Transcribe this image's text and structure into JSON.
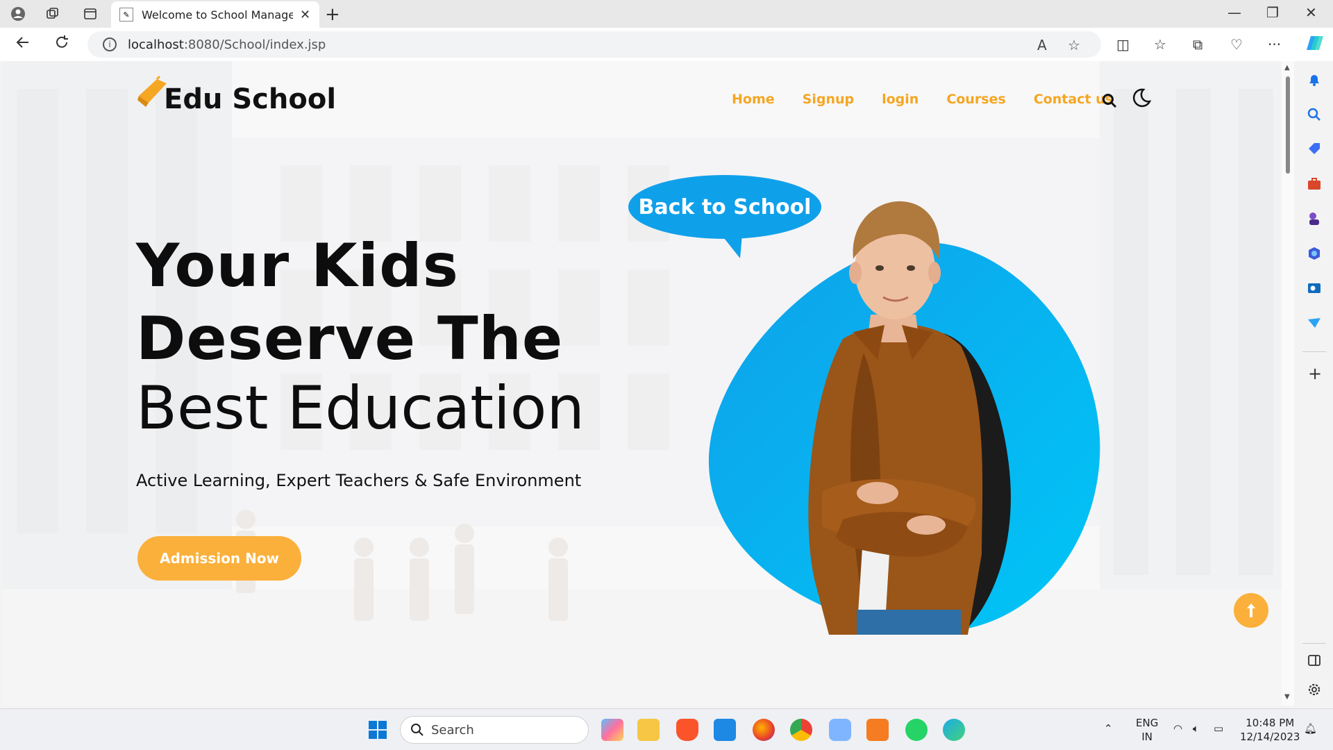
{
  "browser": {
    "tab_title": "Welcome to School Managemen",
    "url_host": "localhost",
    "url_rest": ":8080/School/index.jsp"
  },
  "site": {
    "logo_text": "Edu School",
    "nav": [
      "Home",
      "Signup",
      "login",
      "Courses",
      "Contact us"
    ],
    "bubble_text": "Back to School",
    "hero_line1": "Your Kids",
    "hero_line2": "Deserve The",
    "hero_line3": "Best Education",
    "subtitle": "Active Learning, Expert Teachers & Safe Environment",
    "cta": "Admission Now"
  },
  "taskbar": {
    "search_label": "Search",
    "lang1": "ENG",
    "lang2": "IN",
    "time": "10:48 PM",
    "date": "12/14/2023"
  },
  "colors": {
    "accent": "#fbb03b",
    "nav_text": "#f5a623",
    "blob": "#00aef0"
  }
}
